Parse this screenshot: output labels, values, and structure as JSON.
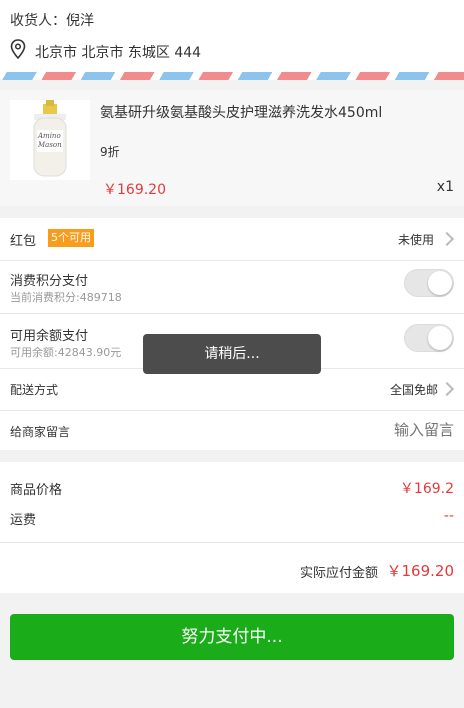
{
  "address": {
    "receiver_label": "收货人：倪洋",
    "location": "北京市 北京市 东城区 444",
    "location_icon": "map-pin-icon"
  },
  "product": {
    "name": "氨基研升级氨基酸头皮护理滋养洗发水450ml",
    "discount": "9折",
    "price": "￥169.20",
    "quantity": "x1",
    "image_text_line1": "Amino",
    "image_text_line2": "Mason"
  },
  "options": {
    "red_packet_label": "红包",
    "red_packet_badge": "5个可用",
    "red_packet_value": "未使用",
    "points_label": "消费积分支付",
    "points_sub": "当前消费积分:489718",
    "balance_label": "可用余额支付",
    "balance_sub": "可用余额:42843.90元",
    "delivery_label": "配送方式",
    "delivery_value": "全国免邮",
    "message_label": "给商家留言",
    "message_placeholder": "输入留言"
  },
  "summary": {
    "goods_price_label": "商品价格",
    "goods_price_value": "￥169.2",
    "shipping_label": "运费",
    "shipping_value": "--",
    "total_label": "实际应付金额",
    "total_value": "￥169.20"
  },
  "toast": "请稍后...",
  "pay_button": "努力支付中...",
  "colors": {
    "price_red": "#e4393c",
    "badge_orange": "#f89c1c",
    "pay_green": "#1aad19",
    "toast_bg": "#4c4c4c"
  }
}
